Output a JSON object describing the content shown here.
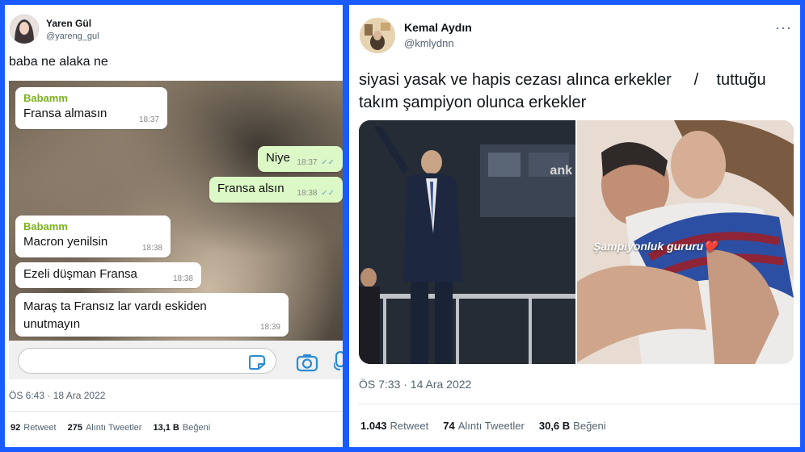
{
  "left_tweet": {
    "author_name": "Yaren Gül",
    "author_handle": "@yareng_gul",
    "text": "baba ne alaka ne",
    "chat": {
      "messages": [
        {
          "sender": "Babamm",
          "text": "Fransa almasın",
          "time": "18:37",
          "direction": "in"
        },
        {
          "text": "Niye",
          "time": "18:37",
          "direction": "out"
        },
        {
          "text": "Fransa alsın",
          "time": "18:38",
          "direction": "out"
        },
        {
          "sender": "Babamm",
          "text": "Macron yenilsin",
          "time": "18:38",
          "direction": "in"
        },
        {
          "text": "Ezeli düşman Fransa",
          "time": "18:38",
          "direction": "in"
        },
        {
          "text": "Maraş ta Fransız lar vardı eskiden unutmayın",
          "time": "18:39",
          "direction": "in"
        }
      ],
      "read_ticks": "✓✓",
      "icons": [
        "sticker-icon",
        "camera-icon",
        "mic-icon"
      ]
    },
    "timestamp": "ÖS 6:43 · 18 Ara 2022",
    "stats": {
      "retweets": "92",
      "retweets_label": "Retweet",
      "quotes": "275",
      "quotes_label": "Alıntı Tweetler",
      "likes": "13,1 B",
      "likes_label": "Beğeni"
    }
  },
  "right_tweet": {
    "author_name": "Kemal Aydın",
    "author_handle": "@kmlydnn",
    "more_icon": "···",
    "text": "siyasi yasak ve hapis cezası alınca erkekler     /    tuttuğu takım şampiyon olunca erkekler",
    "media": {
      "left_logo_text": "ank",
      "right_caption": "Şampiyonluk gururu❤️"
    },
    "timestamp": "ÖS 7:33 · 14 Ara 2022",
    "stats": {
      "retweets": "1.043",
      "retweets_label": "Retweet",
      "quotes": "74",
      "quotes_label": "Alıntı Tweetler",
      "likes": "30,6 B",
      "likes_label": "Beğeni"
    }
  },
  "colors": {
    "frame_blue": "#1a5bff",
    "whatsapp_sender_green": "#7bb01f",
    "outgoing_bubble": "#dcf8c6"
  }
}
